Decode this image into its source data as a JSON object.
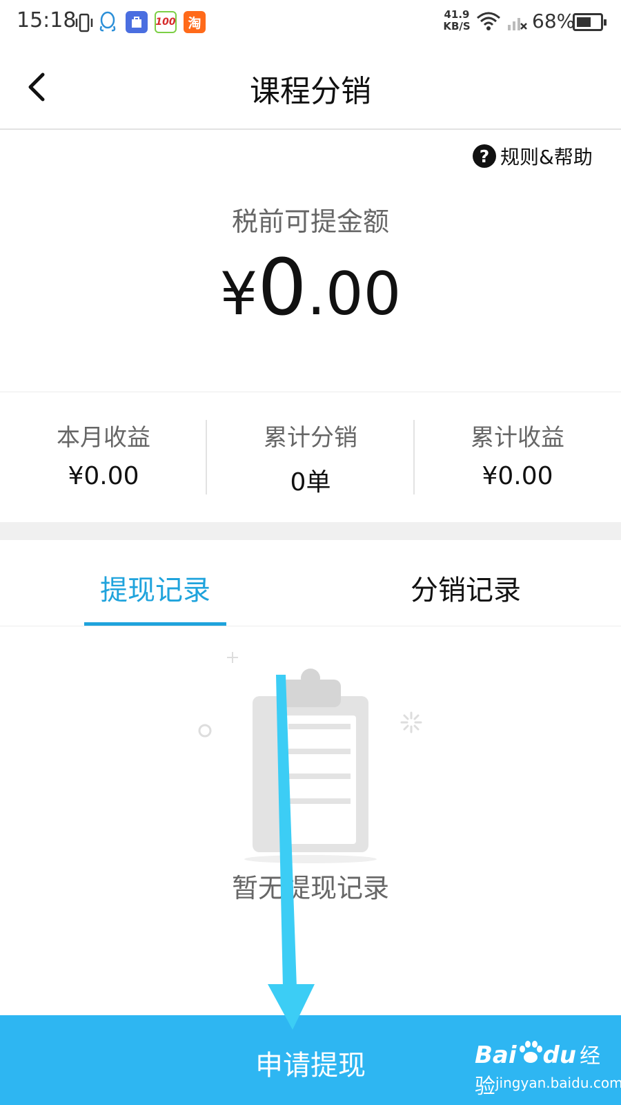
{
  "status_bar": {
    "time": "15:18",
    "app_icons": [
      "vibrate-icon",
      "qq-icon",
      "store-icon",
      "app-100-icon",
      "taobao-icon"
    ],
    "app_100_text": "100",
    "taobao_text": "淘",
    "speed_value": "41.9",
    "speed_unit": "KB/S",
    "battery": "68%",
    "battery_level": 0.68
  },
  "header": {
    "title": "课程分销",
    "back_icon": "chevron-left-icon"
  },
  "help": {
    "label": "规则&帮助",
    "icon_glyph": "?"
  },
  "balance": {
    "label": "税前可提金额",
    "currency": "¥",
    "integer": "0",
    "decimal": ".00"
  },
  "stats": [
    {
      "label": "本月收益",
      "value": "¥0.00"
    },
    {
      "label": "累计分销",
      "value": "0单"
    },
    {
      "label": "累计收益",
      "value": "¥0.00"
    }
  ],
  "tabs": [
    {
      "label": "提现记录",
      "active": true
    },
    {
      "label": "分销记录",
      "active": false
    }
  ],
  "empty_state": {
    "icon": "clipboard-icon",
    "text": "暂无提现记录"
  },
  "bottom_button": {
    "label": "申请提现"
  },
  "watermark": {
    "brand": "Bai",
    "brand_suffix": "du",
    "cn": "经验",
    "url": "jingyan.baidu.com"
  },
  "colors": {
    "accent": "#1fa3dc",
    "button": "#2eb6f2",
    "arrow": "#3ccdf5"
  }
}
